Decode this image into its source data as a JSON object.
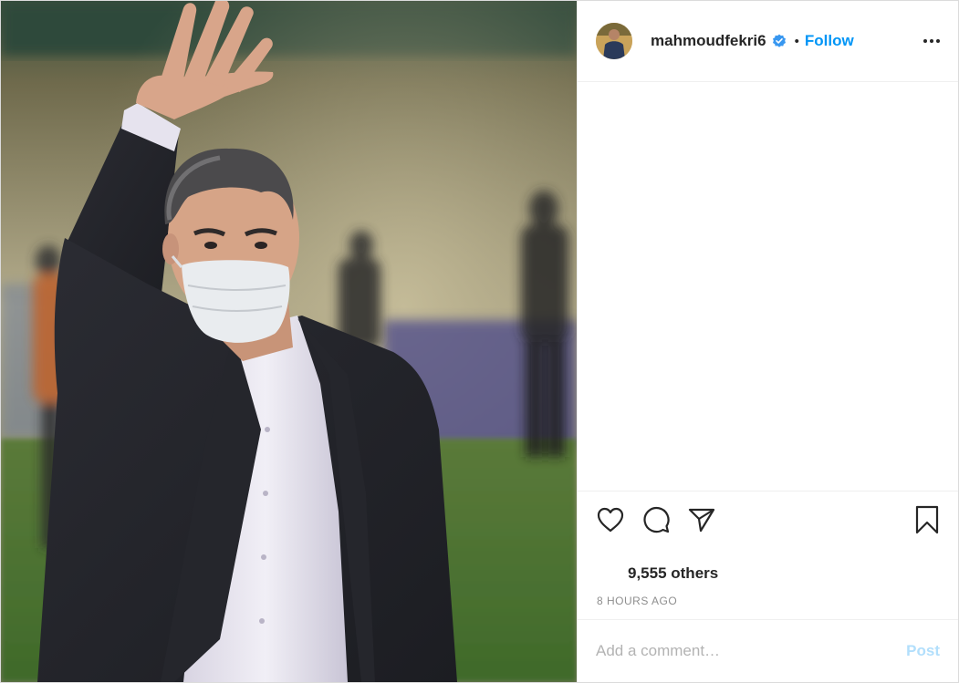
{
  "post": {
    "author": {
      "username": "mahmoudfekri6",
      "verified": true,
      "follow_label": "Follow",
      "separator": "•"
    },
    "image": {
      "subject": "man in dark suit and white face mask waving on football pitch"
    },
    "actions": {
      "like_icon": "heart-icon",
      "comment_icon": "comment-icon",
      "share_icon": "paper-plane-icon",
      "save_icon": "bookmark-icon"
    },
    "likes_text": "9,555 others",
    "timestamp": "8 HOURS AGO",
    "comment": {
      "placeholder": "Add a comment…",
      "post_label": "Post"
    }
  },
  "colors": {
    "accent": "#0095f6",
    "post_disabled": "#b2dffc",
    "text": "#262626",
    "muted": "#8e8e8e",
    "border": "#efefef"
  }
}
